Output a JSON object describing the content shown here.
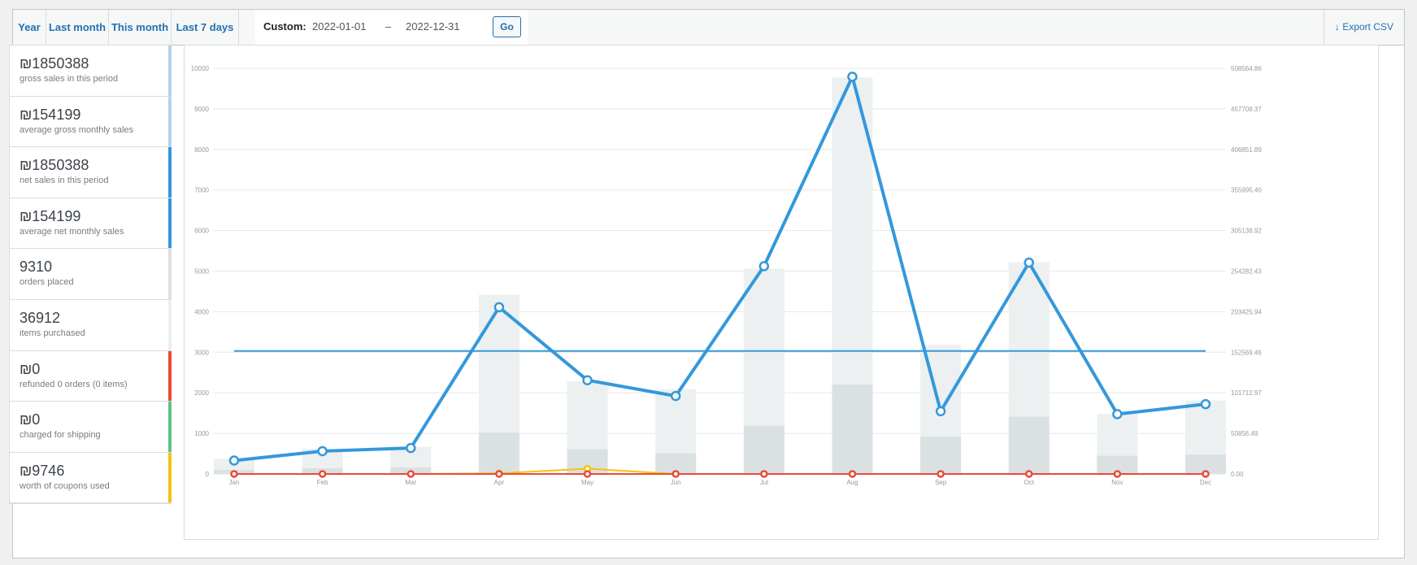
{
  "tabs": [
    "Year",
    "Last month",
    "This month",
    "Last 7 days"
  ],
  "custom": {
    "label": "Custom:",
    "start": "2022-01-01",
    "dash": "–",
    "end": "2022-12-31",
    "go": "Go"
  },
  "export": {
    "label": "Export CSV",
    "icon": "download-arrow-icon"
  },
  "legend": [
    {
      "value": "₪1850388",
      "text": "gross sales in this period",
      "color": "#b1d4ea"
    },
    {
      "value": "₪154199",
      "text": "average gross monthly sales",
      "color": "#b1d4ea"
    },
    {
      "value": "₪1850388",
      "text": "net sales in this period",
      "color": "#3498db"
    },
    {
      "value": "₪154199",
      "text": "average net monthly sales",
      "color": "#3498db"
    },
    {
      "value": "9310",
      "text": "orders placed",
      "color": "#dbe1e3"
    },
    {
      "value": "36912",
      "text": "items purchased",
      "color": "#ecf0f1"
    },
    {
      "value": "₪0",
      "text": "refunded 0 orders (0 items)",
      "color": "#e74c3c"
    },
    {
      "value": "₪0",
      "text": "charged for shipping",
      "color": "#5cc488"
    },
    {
      "value": "₪9746",
      "text": "worth of coupons used",
      "color": "#f1c40f"
    }
  ],
  "chart_data": {
    "type": "bar",
    "categories": [
      "Jan",
      "Feb",
      "Mar",
      "Apr",
      "May",
      "Jun",
      "Jul",
      "Aug",
      "Sep",
      "Oct",
      "Nov",
      "Dec"
    ],
    "y_left": {
      "ticks": [
        "0",
        "1000",
        "2000",
        "3000",
        "4000",
        "5000",
        "6000",
        "7000",
        "8000",
        "9000",
        "10000"
      ],
      "range": [
        0,
        10000
      ]
    },
    "y_right": {
      "ticks": [
        "0.00",
        "50856.49",
        "101712.97",
        "152569.46",
        "203425.94",
        "254282.43",
        "305138.92",
        "355995.40",
        "406851.89",
        "457708.37",
        "508564.86"
      ],
      "range": [
        0,
        508564.86
      ]
    },
    "grid": true,
    "series": [
      {
        "name": "items purchased",
        "axis": "left",
        "kind": "bar",
        "color": "#ecf0f1",
        "values": [
          370,
          620,
          670,
          4420,
          2280,
          2090,
          5060,
          9770,
          3180,
          5220,
          1480,
          1810
        ]
      },
      {
        "name": "orders placed",
        "axis": "left",
        "kind": "bar",
        "color": "#dbe1e3",
        "values": [
          100,
          140,
          160,
          1020,
          610,
          510,
          1190,
          2210,
          920,
          1410,
          450,
          480
        ]
      },
      {
        "name": "net sales in this period",
        "axis": "right",
        "kind": "line",
        "color": "#3498db",
        "values": [
          16800,
          28600,
          32500,
          209000,
          117500,
          97700,
          260500,
          498000,
          78600,
          265000,
          75000,
          87500
        ]
      },
      {
        "name": "average net monthly sales",
        "axis": "right",
        "kind": "line",
        "color": "#3498db",
        "values": [
          154199,
          154199,
          154199,
          154199,
          154199,
          154199,
          154199,
          154199,
          154199,
          154199,
          154199,
          154199
        ]
      },
      {
        "name": "worth of coupons used",
        "axis": "right",
        "kind": "line",
        "color": "#f1c40f",
        "values": [
          0,
          0,
          0,
          800,
          6600,
          0,
          0,
          0,
          0,
          0,
          0,
          0
        ]
      },
      {
        "name": "refunded 0 orders (0 items)",
        "axis": "right",
        "kind": "line",
        "color": "#e74c3c",
        "values": [
          0,
          0,
          0,
          0,
          0,
          0,
          0,
          0,
          0,
          0,
          0,
          0
        ]
      }
    ]
  }
}
